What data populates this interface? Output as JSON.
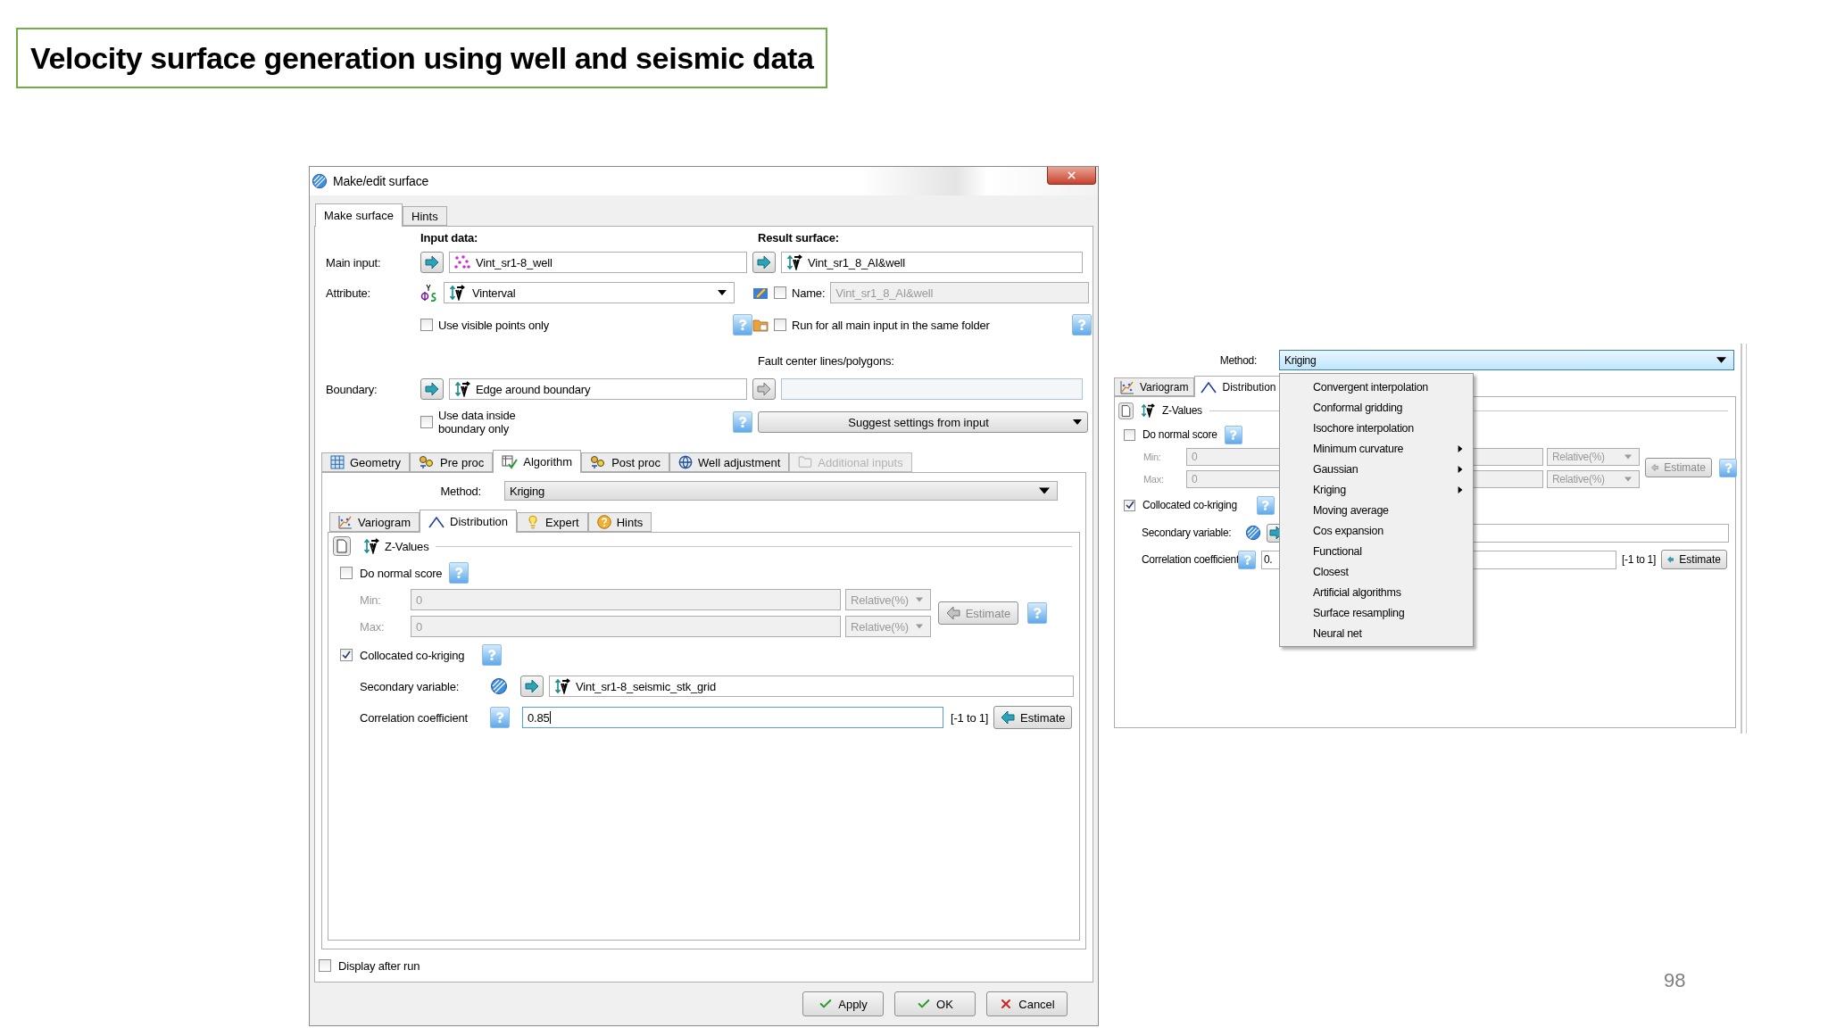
{
  "slide": {
    "title": "Velocity surface generation using well and seismic data",
    "page_number": "98"
  },
  "dialog": {
    "title": "Make/edit surface",
    "tabs": [
      {
        "label": "Make surface",
        "selected": true
      },
      {
        "label": "Hints",
        "selected": false
      }
    ],
    "input_heading": "Input data:",
    "result_heading": "Result surface:",
    "main_input": {
      "label": "Main input:",
      "value": "Vint_sr1-8_well"
    },
    "attribute": {
      "label": "Attribute:",
      "value": "Vinterval"
    },
    "use_visible_points": {
      "label": "Use visible points only",
      "checked": false
    },
    "result": {
      "value": "Vint_sr1_8_AI&well"
    },
    "name": {
      "label": "Name:",
      "checked": false,
      "value": "Vint_sr1_8_AI&well"
    },
    "run_all": {
      "label": "Run for all main input in the same folder",
      "checked": false
    },
    "fault_label": "Fault center lines/polygons:",
    "boundary": {
      "label": "Boundary:",
      "value": "Edge around boundary"
    },
    "use_inside": {
      "label": "Use data inside boundary only",
      "checked": false
    },
    "suggest": "Suggest settings from input",
    "section_tabs": [
      {
        "label": "Geometry",
        "kind": "grid",
        "selected": false,
        "disabled": false
      },
      {
        "label": "Pre proc",
        "kind": "gears",
        "selected": false,
        "disabled": false
      },
      {
        "label": "Algorithm",
        "kind": "table",
        "selected": true,
        "disabled": false
      },
      {
        "label": "Post proc",
        "kind": "gears",
        "selected": false,
        "disabled": false
      },
      {
        "label": "Well adjustment",
        "kind": "globe",
        "selected": false,
        "disabled": false
      },
      {
        "label": "Additional inputs",
        "kind": "folder",
        "selected": false,
        "disabled": true
      }
    ],
    "method": {
      "label": "Method:",
      "value": "Kriging"
    },
    "algo_tabs": [
      {
        "label": "Variogram",
        "kind": "chart",
        "selected": false
      },
      {
        "label": "Distribution",
        "kind": "curve",
        "selected": true
      },
      {
        "label": "Expert",
        "kind": "bulb",
        "selected": false
      },
      {
        "label": "Hints",
        "kind": "help",
        "selected": false
      }
    ],
    "z_values": "Z-Values",
    "normal_score": {
      "label": "Do normal score",
      "checked": false
    },
    "min": {
      "label": "Min:",
      "value": "0",
      "unit": "Relative(%)"
    },
    "max": {
      "label": "Max:",
      "value": "0",
      "unit": "Relative(%)"
    },
    "range_estimate": {
      "label": "Estimate",
      "disabled": true
    },
    "cokriging": {
      "label": "Collocated co-kriging",
      "checked": true
    },
    "secondary": {
      "label": "Secondary variable:",
      "value": "Vint_sr1-8_seismic_stk_grid"
    },
    "correlation": {
      "label": "Correlation coefficient",
      "value": "0.85",
      "range": "[-1 to 1]",
      "estimate": "Estimate"
    },
    "display_after_run": {
      "label": "Display after run",
      "checked": false
    },
    "buttons": [
      {
        "label": "Apply",
        "kind": "confirm"
      },
      {
        "label": "OK",
        "kind": "confirm"
      },
      {
        "label": "Cancel",
        "kind": "cancel"
      }
    ]
  },
  "inset": {
    "method": {
      "label": "Method:",
      "value": "Kriging"
    },
    "tabs": [
      {
        "label": "Variogram",
        "kind": "chart",
        "selected": false
      },
      {
        "label": "Distribution",
        "kind": "curve",
        "selected": true
      }
    ],
    "z_values": "Z-Values",
    "normal_score": {
      "label": "Do normal score",
      "checked": false
    },
    "min": {
      "label": "Min:",
      "value": "0",
      "unit": "Relative(%)"
    },
    "max": {
      "label": "Max:",
      "value": "0",
      "unit": "Relative(%)"
    },
    "range_estimate": "Estimate",
    "cokriging": {
      "label": "Collocated co-kriging",
      "checked": true
    },
    "secondary_label": "Secondary variable:",
    "correlation": {
      "label": "Correlation coefficient",
      "value": "0.",
      "range": "[-1 to 1]",
      "estimate": "Estimate"
    },
    "menu": [
      {
        "label": "Convergent interpolation",
        "submenu": false
      },
      {
        "label": "Conformal gridding",
        "submenu": false
      },
      {
        "label": "Isochore interpolation",
        "submenu": false
      },
      {
        "label": "Minimum curvature",
        "submenu": true
      },
      {
        "label": "Gaussian",
        "submenu": true
      },
      {
        "label": "Kriging",
        "submenu": true
      },
      {
        "label": "Moving average",
        "submenu": false
      },
      {
        "label": "Cos expansion",
        "submenu": false
      },
      {
        "label": "Functional",
        "submenu": false
      },
      {
        "label": "Closest",
        "submenu": false
      },
      {
        "label": "Artificial algorithms",
        "submenu": false
      },
      {
        "label": "Surface resampling",
        "submenu": false
      },
      {
        "label": "Neural net",
        "submenu": false
      }
    ]
  }
}
